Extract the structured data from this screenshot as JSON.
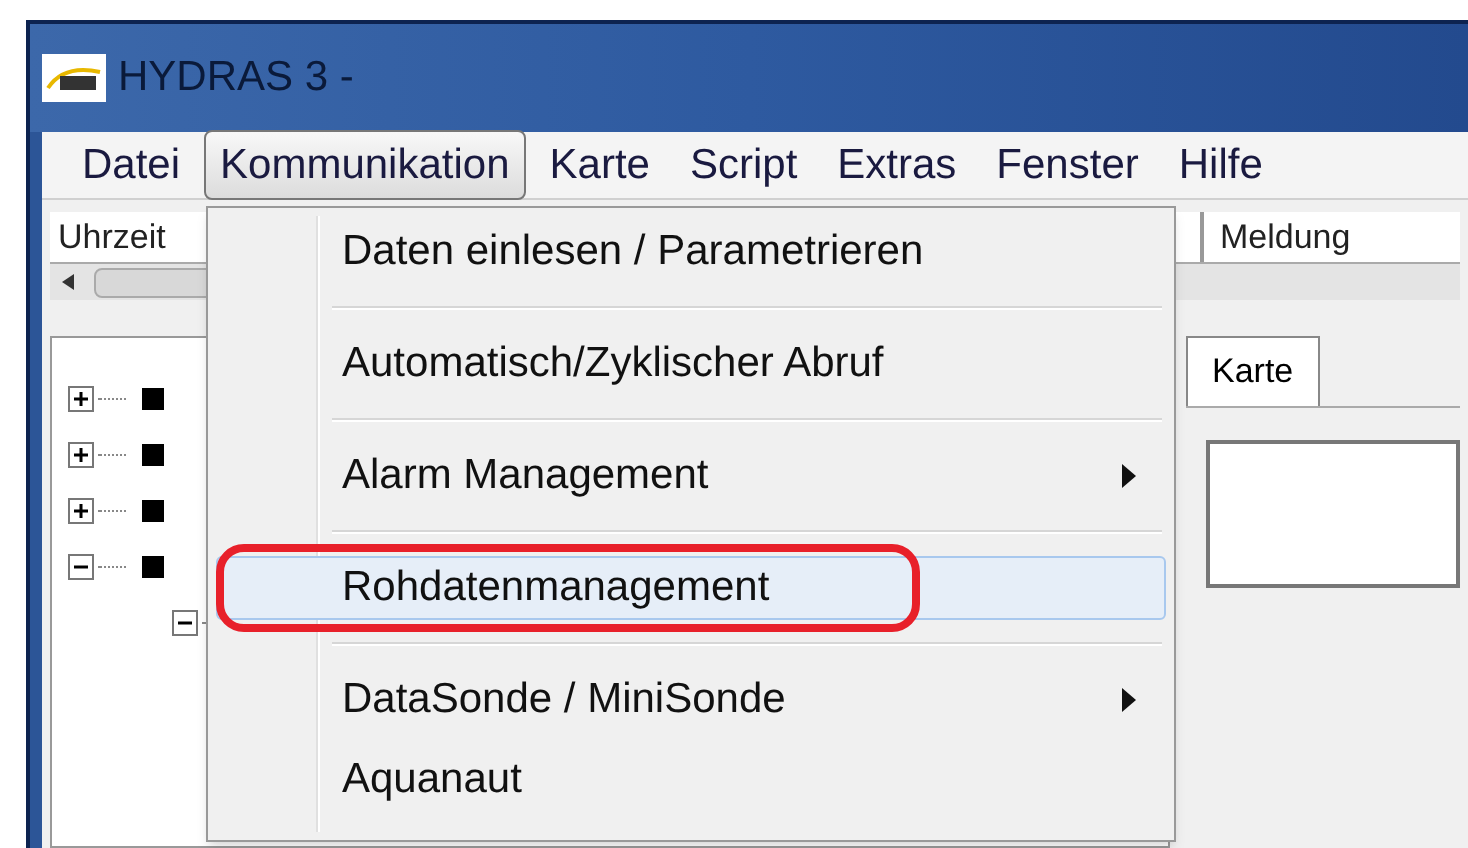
{
  "window": {
    "title": "HYDRAS 3 -"
  },
  "menu_bar": [
    {
      "label": "Datei",
      "selected": false
    },
    {
      "label": "Kommunikation",
      "selected": true
    },
    {
      "label": "Karte",
      "selected": false
    },
    {
      "label": "Script",
      "selected": false
    },
    {
      "label": "Extras",
      "selected": false
    },
    {
      "label": "Fenster",
      "selected": false
    },
    {
      "label": "Hilfe",
      "selected": false
    }
  ],
  "log_columns": [
    {
      "label": "Uhrzeit"
    },
    {
      "label": "Meldung"
    }
  ],
  "tree": [
    {
      "expanded": false
    },
    {
      "expanded": false
    },
    {
      "expanded": false
    },
    {
      "expanded": true,
      "children": [
        {
          "expanded": true
        }
      ]
    }
  ],
  "tabs": [
    {
      "label": "Karte",
      "selected": true
    }
  ],
  "dropdown": [
    {
      "label": "Daten einlesen / Parametrieren",
      "submenu": false,
      "highlighted": false,
      "annotated": false,
      "separator_after": true
    },
    {
      "label": "Automatisch/Zyklischer Abruf",
      "submenu": false,
      "highlighted": false,
      "annotated": false,
      "separator_after": true
    },
    {
      "label": "Alarm Management",
      "submenu": true,
      "highlighted": false,
      "annotated": false,
      "separator_after": true
    },
    {
      "label": "Rohdatenmanagement",
      "submenu": false,
      "highlighted": true,
      "annotated": true,
      "separator_after": true
    },
    {
      "label": "DataSonde / MiniSonde",
      "submenu": true,
      "highlighted": false,
      "annotated": false,
      "separator_after": false
    },
    {
      "label": "Aquanaut",
      "submenu": false,
      "highlighted": false,
      "annotated": false,
      "separator_after": false
    }
  ]
}
